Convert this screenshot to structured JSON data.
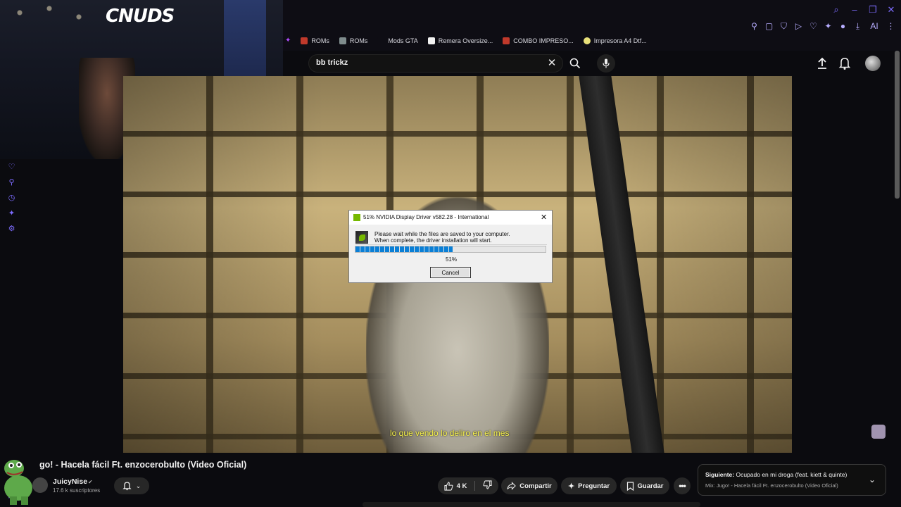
{
  "browser": {
    "window_controls": [
      "search-icon",
      "minimize-icon",
      "restore-icon",
      "close-icon"
    ],
    "bookmarks": [
      {
        "label": "ROMs",
        "color": "#c0392b"
      },
      {
        "label": "ROMs",
        "color": "#7f8c8d"
      },
      {
        "label": "Mods GTA",
        "color": "#333333"
      },
      {
        "label": "Remera Oversize...",
        "color": "#f2f2f2"
      },
      {
        "label": "COMBO IMPRESO...",
        "color": "#c0392b"
      },
      {
        "label": "Impresora A4 Dtf...",
        "color": "#e8e07a"
      }
    ],
    "ai_button": "AI"
  },
  "search": {
    "query": "bb trickz"
  },
  "webcam": {
    "logo_text": "CNUDS"
  },
  "video": {
    "subtitle": "lo que vendo lo deliro en el mes",
    "title": "go! - Hacela fácil Ft. enzocerobulto (Video Oficial)"
  },
  "dialog": {
    "title": "51% NVIDIA Display Driver v582.28 - International",
    "message_line1": "Please wait while the files are saved to your computer.",
    "message_line2": "When complete, the driver installation will start.",
    "progress_fraction": 0.51,
    "percent_label": "51%",
    "cancel_label": "Cancel"
  },
  "channel": {
    "name": "JuicyNise",
    "subscribers": "17.6 k suscriptores"
  },
  "actions": {
    "likes": "4 K",
    "share": "Compartir",
    "ask": "Preguntar",
    "save": "Guardar"
  },
  "next": {
    "prefix": "Siguiente:",
    "title": "Ocupado en mi droga (feat. kiett & quinte)",
    "mix": "Mix: Jugo! - Hacela fácil Ft. enzocerobulto (Video Oficial)"
  }
}
